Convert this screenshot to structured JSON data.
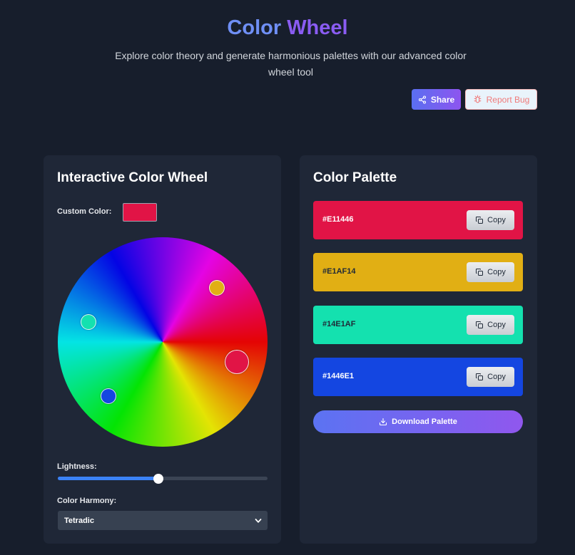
{
  "header": {
    "title_part1": "Color",
    "title_part2": "Wheel",
    "subtitle": "Explore color theory and generate harmonious palettes with our advanced color wheel tool",
    "share_label": "Share",
    "report_bug_label": "Report Bug"
  },
  "wheel_panel": {
    "title": "Interactive Color Wheel",
    "custom_color_label": "Custom Color:",
    "custom_color_value": "#E11446",
    "markers": [
      {
        "name": "marker-primary",
        "color": "#E11446",
        "hue_deg": 345
      },
      {
        "name": "marker-second",
        "color": "#E1AF14",
        "hue_deg": 45
      },
      {
        "name": "marker-third",
        "color": "#14E1AF",
        "hue_deg": 165
      },
      {
        "name": "marker-fourth",
        "color": "#1446E1",
        "hue_deg": 225
      }
    ],
    "lightness_label": "Lightness:",
    "lightness_value": 0.48,
    "harmony_label": "Color Harmony:",
    "harmony_selected": "Tetradic"
  },
  "palette_panel": {
    "title": "Color Palette",
    "copy_label": "Copy",
    "swatches": [
      {
        "hex": "#E11446",
        "bg": "#e11446",
        "text_color": "#ffffff"
      },
      {
        "hex": "#E1AF14",
        "bg": "#e1af14",
        "text_color": "#1f2937"
      },
      {
        "hex": "#14E1AF",
        "bg": "#14e1af",
        "text_color": "#1f2937"
      },
      {
        "hex": "#1446E1",
        "bg": "#1446e1",
        "text_color": "#ffffff"
      }
    ],
    "download_label": "Download Palette"
  }
}
